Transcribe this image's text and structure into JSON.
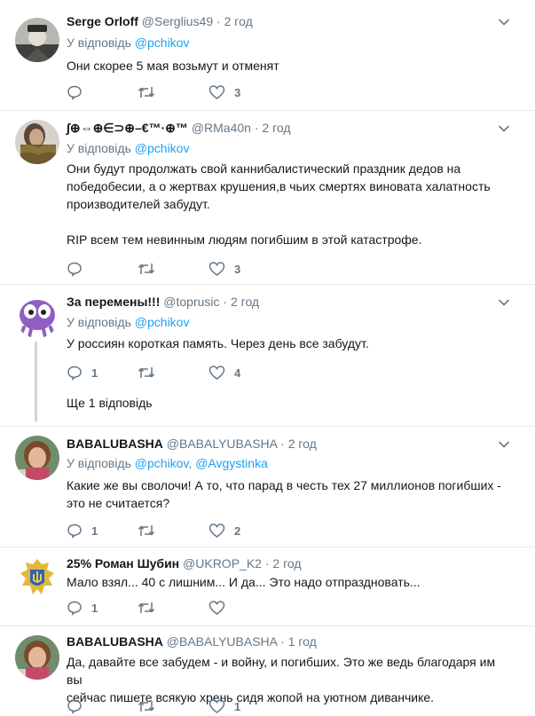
{
  "tweets": [
    {
      "name": "Serge Orloff",
      "handle": "@Serglius49",
      "time": "2 год",
      "reply_label": "У відповідь",
      "reply_mentions": "@pchikov",
      "text": [
        "Они скорее 5 мая возьмут и отменят"
      ],
      "likes": "3"
    },
    {
      "name": "∫⊕⇔⊕∈⊃⊕–€™·⊕™",
      "handle": "@RMa40n",
      "time": "2 год",
      "reply_label": "У відповідь",
      "reply_mentions": "@pchikov",
      "text": [
        "Они будут продолжать свой  каннибалистический праздник дедов на",
        "победобесии, а о жертвах крушения,в чьих смертях виновата халатность",
        "производителей забудут.",
        "",
        "RIP всем тем невинным людям погибшим в этой катастрофе."
      ],
      "likes": "3"
    },
    {
      "name": "За перемены!!!",
      "handle": "@toprusic",
      "time": "2 год",
      "reply_label": "У відповідь",
      "reply_mentions": "@pchikov",
      "text": [
        "У россиян короткая память. Через день все забудут."
      ],
      "replies": "1",
      "likes": "4",
      "more_replies": "Ще 1 відповідь"
    },
    {
      "name": "BABALUBASHA",
      "handle": "@BABALYUBASHA",
      "time": "2 год",
      "reply_label": "У відповідь",
      "reply_mentions": "@pchikov, @Avgystinka",
      "text": [
        "Какие же вы сволочи! А то, что парад в честь тех 27 миллионов погибших -",
        "это не считается?"
      ],
      "replies": "1",
      "likes": "2"
    },
    {
      "name": "25% Роман Шубин",
      "handle": "@UKROP_K2",
      "time": "2 год",
      "text": [
        "Мало взял... 40 с лишним... И да... Это надо отпраздновать..."
      ],
      "replies": "1"
    },
    {
      "name": "BABALUBASHA",
      "handle": "@BABALYUBASHA",
      "time": "1 год",
      "text": [
        "Да, давайте все забудем - и войну, и погибших. Это же ведь благодаря им вы",
        "сейчас пишете всякую хрень сидя жопой на уютном диванчике."
      ],
      "likes": "1"
    }
  ],
  "colors": {
    "secondary": "#657786",
    "link": "#1da1f2",
    "divider": "#e6ecf0",
    "thread": "#ccd6dd"
  },
  "icons": [
    "reply-icon",
    "retweet-icon",
    "like-icon",
    "chevron-down-icon"
  ]
}
